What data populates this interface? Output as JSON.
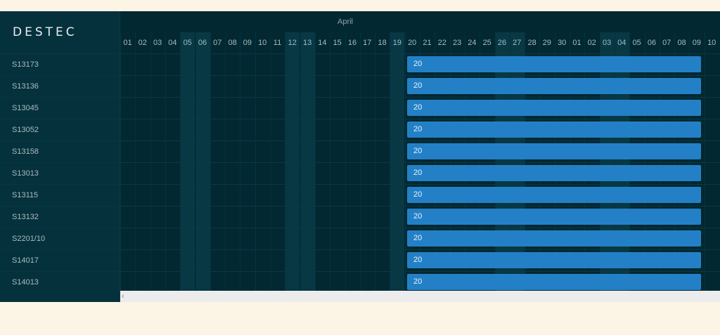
{
  "brand": "DESTEC",
  "month_label": "April",
  "days": [
    "01",
    "02",
    "03",
    "04",
    "05",
    "06",
    "07",
    "08",
    "09",
    "10",
    "11",
    "12",
    "13",
    "14",
    "15",
    "16",
    "17",
    "18",
    "19",
    "20",
    "21",
    "22",
    "23",
    "24",
    "25",
    "26",
    "27",
    "28",
    "29",
    "30",
    "01",
    "02",
    "03",
    "04",
    "05",
    "06",
    "07",
    "08",
    "09",
    "10"
  ],
  "weekend_columns": [
    4,
    5,
    11,
    12,
    18,
    25,
    26,
    32,
    33
  ],
  "rows": [
    {
      "label": "S13173",
      "bar_label": "20"
    },
    {
      "label": "S13136",
      "bar_label": "20"
    },
    {
      "label": "S13045",
      "bar_label": "20"
    },
    {
      "label": "S13052",
      "bar_label": "20"
    },
    {
      "label": "S13158",
      "bar_label": "20"
    },
    {
      "label": "S13013",
      "bar_label": "20"
    },
    {
      "label": "S13115",
      "bar_label": "20"
    },
    {
      "label": "S13132",
      "bar_label": "20"
    },
    {
      "label": "S2201/10",
      "bar_label": "20"
    },
    {
      "label": "S14017",
      "bar_label": "20"
    },
    {
      "label": "S14013",
      "bar_label": "20"
    }
  ],
  "scroll_arrow": "‹",
  "colors": {
    "background": "#fcf4e4",
    "panel": "#022832",
    "bar": "#2380c6"
  }
}
